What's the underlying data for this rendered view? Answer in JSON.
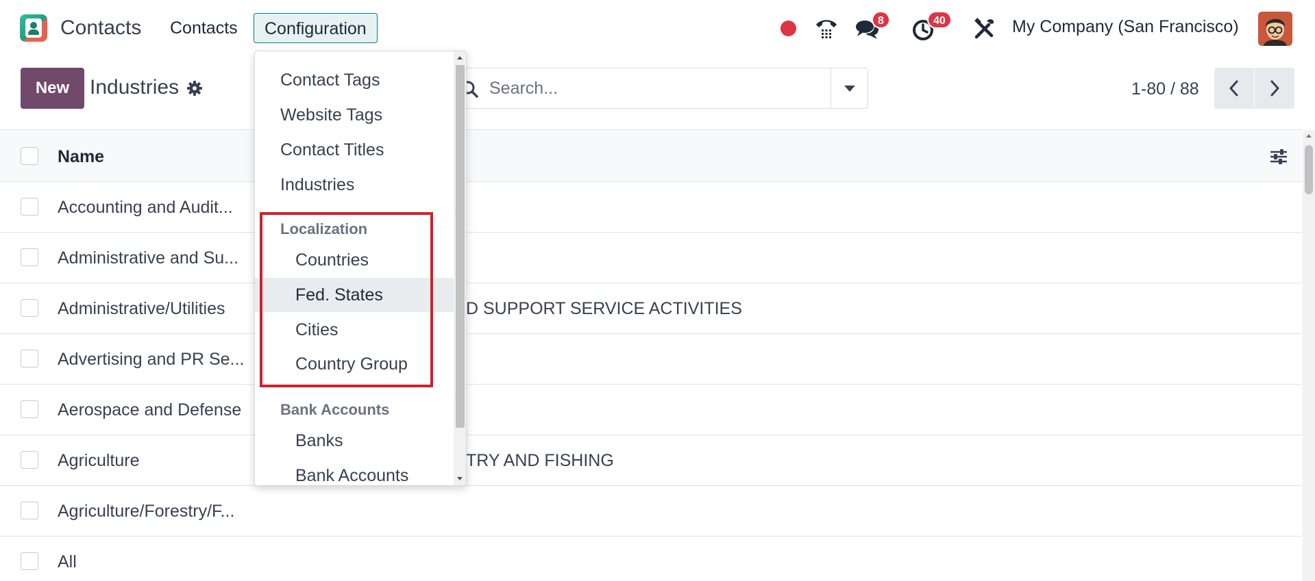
{
  "navbar": {
    "app_name": "Contacts",
    "menu": [
      "Contacts",
      "Configuration"
    ],
    "messages_badge": "8",
    "activities_badge": "40",
    "company": "My Company (San Francisco)",
    "icons": [
      "recording-dot-icon",
      "phone-icon",
      "messages-icon",
      "activity-clock-icon",
      "tools-icon",
      "user-avatar"
    ]
  },
  "control_panel": {
    "new_label": "New",
    "breadcrumb": "Industries",
    "search_placeholder": "Search...",
    "pager_value": "1-80 / 88"
  },
  "list": {
    "column_header": "Name",
    "rows": [
      {
        "name": "Accounting and Audit...",
        "full_name": ""
      },
      {
        "name": "Administrative and Su...",
        "full_name": ""
      },
      {
        "name": "Administrative/Utilities",
        "full_name": "D SUPPORT SERVICE ACTIVITIES"
      },
      {
        "name": "Advertising and PR Se...",
        "full_name": ""
      },
      {
        "name": "Aerospace and Defense",
        "full_name": ""
      },
      {
        "name": "Agriculture",
        "full_name": "TRY AND FISHING"
      },
      {
        "name": "Agriculture/Forestry/F...",
        "full_name": ""
      },
      {
        "name": "All",
        "full_name": ""
      }
    ]
  },
  "dropdown": {
    "items": [
      "Contact Tags",
      "Website Tags",
      "Contact Titles",
      "Industries"
    ],
    "localization_header": "Localization",
    "localization_items": [
      "Countries",
      "Fed. States",
      "Cities",
      "Country Group"
    ],
    "bank_header": "Bank Accounts",
    "bank_items": [
      "Banks",
      "Bank Accounts"
    ],
    "active_item": "Fed. States"
  },
  "colors": {
    "brand": "#71496b",
    "accent": "#017e84",
    "badge": "#dc3545",
    "highlight_box": "#d11f2e"
  }
}
